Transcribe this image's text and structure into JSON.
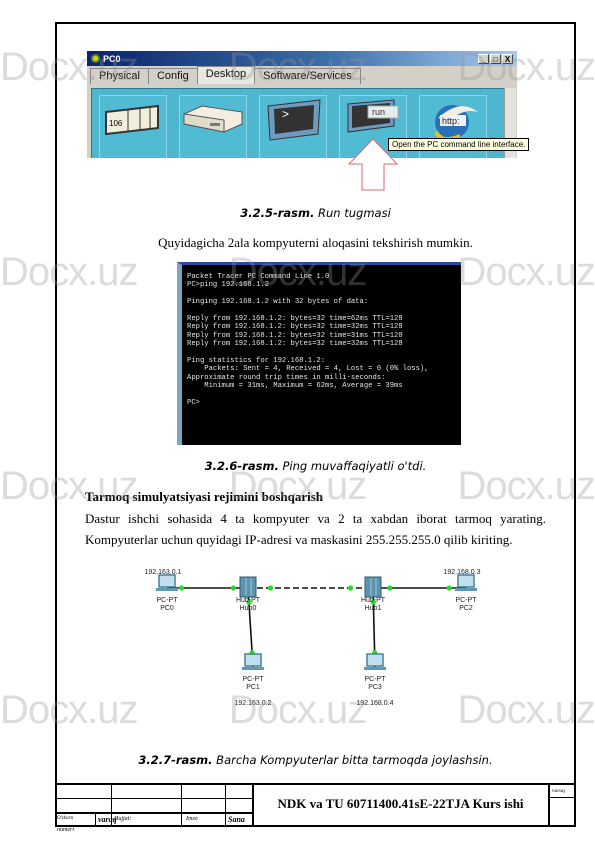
{
  "watermark": "Docx.uz",
  "figure1": {
    "window_title": "PC0",
    "window_controls": [
      "_",
      "□",
      "X"
    ],
    "tabs": [
      {
        "label": "Physical",
        "active": false
      },
      {
        "label": "Config",
        "active": false
      },
      {
        "label": "Desktop",
        "active": true
      },
      {
        "label": "Software/Services",
        "active": false
      }
    ],
    "desktop_tiles": [
      {
        "icon": "ip-configuration-icon",
        "text": "106"
      },
      {
        "icon": "dial-up-icon",
        "text": ""
      },
      {
        "icon": "terminal-icon",
        "text": ">"
      },
      {
        "icon": "command-prompt-icon",
        "text": "run"
      },
      {
        "icon": "web-browser-icon",
        "text": "http:"
      }
    ],
    "tooltip": "Open the PC command line interface.",
    "caption_num": "3.2.5-rasm.",
    "caption_text": " Run tugmasi"
  },
  "paragraph1": "Quyidagicha 2ala kompyuterni aloqasini tekshirish mumkin.",
  "figure2": {
    "terminal_lines": [
      "Packet Tracer PC Command Line 1.0",
      "PC>ping 192.168.1.2",
      "",
      "Pinging 192.168.1.2 with 32 bytes of data:",
      "",
      "Reply from 192.168.1.2: bytes=32 time=62ms TTL=128",
      "Reply from 192.168.1.2: bytes=32 time=32ms TTL=128",
      "Reply from 192.168.1.2: bytes=32 time=31ms TTL=128",
      "Reply from 192.168.1.2: bytes=32 time=32ms TTL=128",
      "",
      "Ping statistics for 192.168.1.2:",
      "    Packets: Sent = 4, Received = 4, Lost = 0 (0% loss),",
      "Approximate round trip times in milli-seconds:",
      "    Minimum = 31ms, Maximum = 62ms, Average = 39ms",
      "",
      "PC>"
    ],
    "caption_num": "3.2.6-rasm.",
    "caption_text": " Ping muvaffaqiyatli o'tdi."
  },
  "section_heading": "Tarmoq simulyatsiyasi rejimini boshqarish",
  "paragraph2": "Dastur ishchi sohasida  4 ta kompyuter va 2 ta xabdan iborat tarmoq yarating. Kompyuterlar uchun quyidagi IP-adresi va maskasini 255.255.255.0 qilib kiriting.",
  "figure3": {
    "nodes": [
      {
        "id": "PC0",
        "type": "PC-PT",
        "ip": "192.163.0.1"
      },
      {
        "id": "Hub0",
        "type": "Hub-PT",
        "ip": ""
      },
      {
        "id": "Hub1",
        "type": "Hub-PT",
        "ip": ""
      },
      {
        "id": "PC2",
        "type": "PC-PT",
        "ip": "192.168.0.3"
      },
      {
        "id": "PC1",
        "type": "PC-PT",
        "ip": "192.163.0.2"
      },
      {
        "id": "PC3",
        "type": "PC-PT",
        "ip": "192.168.0.4"
      }
    ],
    "links": [
      {
        "from": "PC0",
        "to": "Hub0",
        "style": "solid"
      },
      {
        "from": "Hub0",
        "to": "Hub1",
        "style": "dashed"
      },
      {
        "from": "Hub1",
        "to": "PC2",
        "style": "solid"
      },
      {
        "from": "Hub0",
        "to": "PC1",
        "style": "solid"
      },
      {
        "from": "Hub1",
        "to": "PC3",
        "style": "solid"
      }
    ],
    "link_status_color": "#22dd22",
    "caption_num": "3.2.7-rasm.",
    "caption_text": " Barcha Kompyuterlar bitta tarmoqda joylashsin."
  },
  "footer": {
    "title": "NDK va TU  60711400.41sE-22TJA Kurs ishi",
    "labels": {
      "ozgarish": "O'zbarn",
      "varaq": "varaq",
      "hujjat": "Hujjat:",
      "imzo": "Imzo",
      "sana": "Sana",
      "nomeri": "nomeri",
      "varaq_right": "varaq"
    }
  }
}
